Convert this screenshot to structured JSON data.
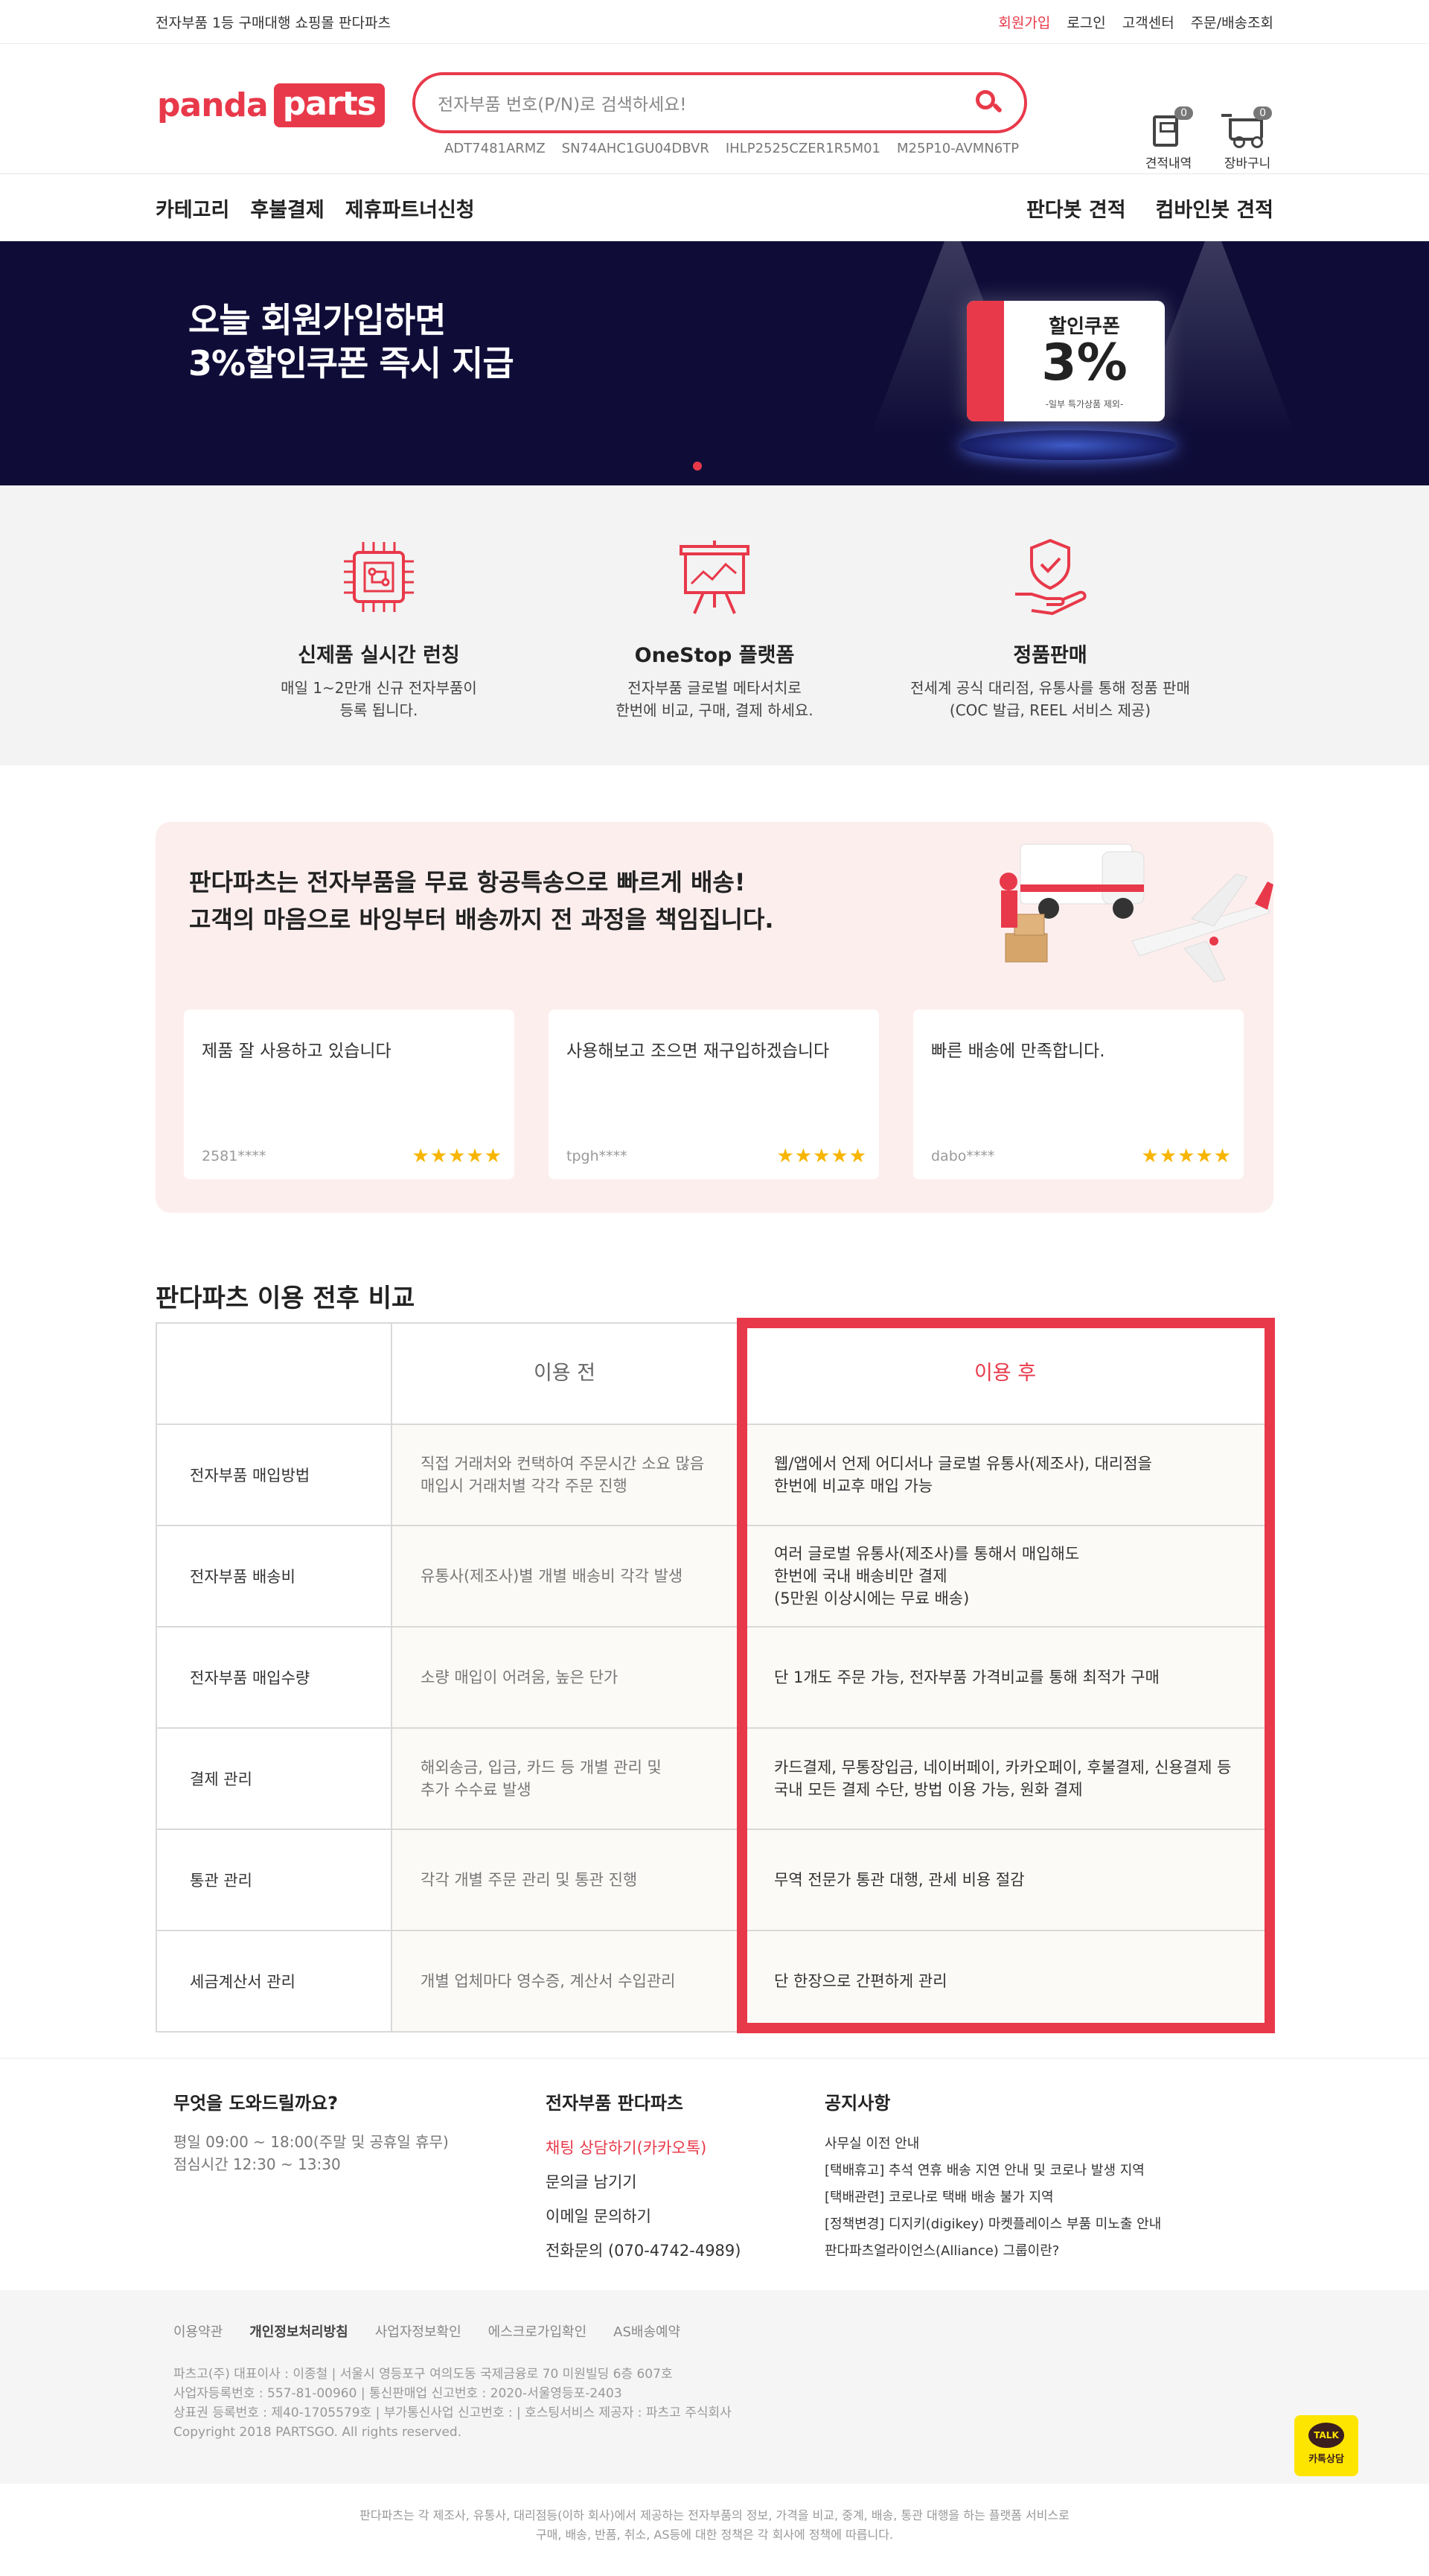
{
  "topbar": {
    "tagline": "전자부품 1등 구매대행 쇼핑몰 판다파츠",
    "links": [
      "회원가입",
      "로그인",
      "고객센터",
      "주문/배송조회"
    ]
  },
  "header": {
    "logo": {
      "panda": "panda",
      "parts": "parts"
    },
    "search_placeholder": "전자부품 번호(P/N)로 검색하세요!",
    "keywords": [
      "ADT7481ARMZ",
      "SN74AHC1GU04DBVR",
      "IHLP2525CZER1R5M01",
      "M25P10-AVMN6TP"
    ],
    "quote": {
      "label": "견적내역",
      "count": "0"
    },
    "cart": {
      "label": "장바구니",
      "count": "0"
    }
  },
  "nav": {
    "left": [
      "카테고리",
      "후불결제",
      "제휴파트너신청"
    ],
    "right": [
      "판다봇 견적",
      "컴바인봇 견적"
    ]
  },
  "banner": {
    "line1": "오늘 회원가입하면",
    "line2": "3%할인쿠폰 즉시 지급",
    "coupon_title": "할인쿠폰",
    "coupon_pct": "3%",
    "coupon_note": "-일부 특가상품 제외-"
  },
  "features": [
    {
      "icon": "chip-icon",
      "title": "신제품 실시간 런칭",
      "desc1": "매일 1~2만개 신규 전자부품이",
      "desc2": "등록 됩니다."
    },
    {
      "icon": "presentation-icon",
      "title": "OneStop 플랫폼",
      "desc1": "전자부품 글로벌 메타서치로",
      "desc2": "한번에 비교, 구매, 결제 하세요."
    },
    {
      "icon": "shield-hand-icon",
      "title": "정품판매",
      "desc1": "전세계 공식 대리점, 유통사를 통해 정품 판매",
      "desc2": "(COC 발급, REEL 서비스 제공)"
    }
  ],
  "delivery": {
    "line1": "판다파츠는 전자부품을 무료 항공특송으로 빠르게 배송!",
    "line2": "고객의 마음으로 바잉부터 배송까지 전 과정을 책임집니다.",
    "reviews": [
      {
        "text": "제품 잘 사용하고 있습니다",
        "user": "2581****",
        "stars": "★★★★★"
      },
      {
        "text": "사용해보고 조으면 재구입하겠습니다",
        "user": "tpgh****",
        "stars": "★★★★★"
      },
      {
        "text": "빠른 배송에 만족합니다.",
        "user": "dabo****",
        "stars": "★★★★★"
      }
    ]
  },
  "comparison": {
    "title": "판다파츠 이용 전후 비교",
    "header_before": "이용 전",
    "header_after": "이용 후",
    "rows": [
      {
        "label": "전자부품 매입방법",
        "before": [
          "직접 거래처와 컨택하여 주문시간 소요 많음",
          "매입시 거래처별 각각 주문 진행"
        ],
        "after": [
          "웹/앱에서 언제 어디서나 글로벌 유통사(제조사), 대리점을",
          "한번에 비교후 매입 가능"
        ]
      },
      {
        "label": "전자부품 배송비",
        "before": [
          "유통사(제조사)별 개별 배송비 각각 발생"
        ],
        "after": [
          "여러 글로벌 유통사(제조사)를 통해서 매입해도",
          "한번에 국내 배송비만 결제",
          "(5만원 이상시에는 무료 배송)"
        ]
      },
      {
        "label": "전자부품 매입수량",
        "before": [
          "소량 매입이 어려움, 높은 단가"
        ],
        "after": [
          "단 1개도 주문 가능, 전자부품 가격비교를 통해 최적가 구매"
        ]
      },
      {
        "label": "결제 관리",
        "before": [
          "해외송금, 입금, 카드 등 개별 관리 및",
          "추가 수수료 발생"
        ],
        "after": [
          "카드결제, 무통장입금, 네이버페이, 카카오페이, 후불결제, 신용결제 등",
          "국내 모든 결제 수단, 방법 이용 가능, 원화 결제"
        ]
      },
      {
        "label": "통관 관리",
        "before": [
          "각각 개별 주문 관리 및 통관 진행"
        ],
        "after": [
          "무역 전문가 통관 대행, 관세 비용 절감"
        ]
      },
      {
        "label": "세금계산서 관리",
        "before": [
          "개별 업체마다 영수증, 계산서 수입관리"
        ],
        "after": [
          "단 한장으로 간편하게 관리"
        ]
      }
    ]
  },
  "help": {
    "col1": {
      "title": "무엇을 도와드릴까요?",
      "hours1": "평일 09:00 ~ 18:00(주말 및 공휴일 휴무)",
      "hours2": "점심시간 12:30 ~ 13:30"
    },
    "col2": {
      "title": "전자부품 판다파츠",
      "links": [
        "채팅 상담하기(카카오톡)",
        "문의글 남기기",
        "이메일 문의하기",
        "전화문의 (070-4742-4989)"
      ]
    },
    "col3": {
      "title": "공지사항",
      "notices": [
        "사무실 이전 안내",
        "[택배휴고] 추석 연휴 배송 지연 안내 및 코로나 발생 지역",
        "[택배관련] 코로나로 택배 배송 불가 지역",
        "[정책변경] 디지키(digikey) 마켓플레이스 부품 미노출 안내",
        "판다파츠얼라이언스(Alliance) 그룹이란?"
      ]
    }
  },
  "footer": {
    "links": [
      "이용약관",
      "개인정보처리방침",
      "사업자정보확인",
      "에스크로가입확인",
      "AS배송예약"
    ],
    "info": [
      "파츠고(주) 대표이사 : 이종철 | 서울시 영등포구 여의도동 국제금융로 70 미원빌딩 6층 607호",
      "사업자등록번호 : 557-81-00960 | 통신판매업 신고번호 : 2020-서울영등포-2403",
      "상표권 등록번호 : 제40-1705579호 | 부가통신사업 신고번호 : | 호스팅서비스 제공자 : 파츠고 주식회사",
      "Copyright 2018 PARTSGO. All rights reserved."
    ],
    "talk_bubble": "TALK",
    "talk_label": "카톡상담",
    "bottom1": "판다파츠는 각 제조사, 유통사, 대리점등(이하 회사)에서 제공하는 전자부품의 정보, 가격을 비교, 중계, 배송, 통관 대행을 하는 플랫폼 서비스로",
    "bottom2": "구매, 배송, 반품, 취소, AS등에 대한 정책은 각 회사에 정책에 따릅니다."
  },
  "colors": {
    "accent": "#e8394a",
    "banner_bg": "#0f0d38",
    "delivery_bg": "#fdeeee",
    "star": "#f7b500"
  }
}
